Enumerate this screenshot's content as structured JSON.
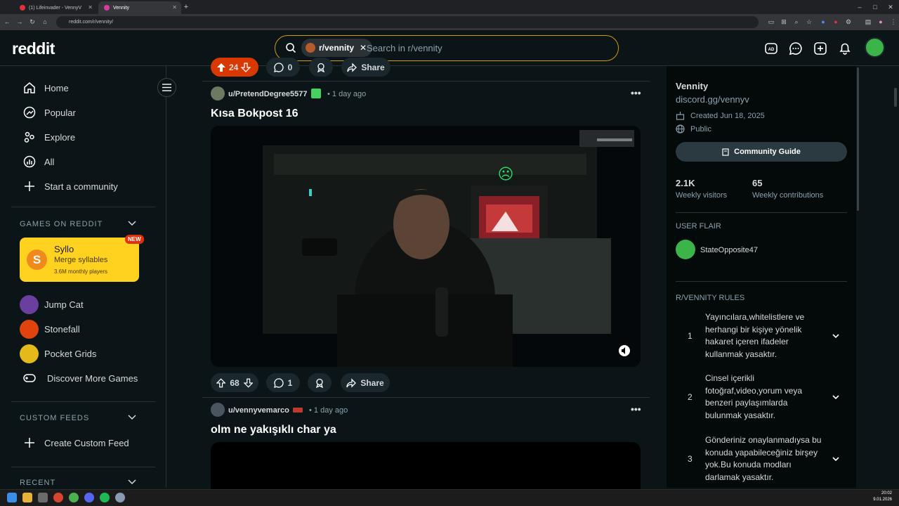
{
  "browser": {
    "tabs": [
      {
        "label": "(1) Lifeinvader - VennyV",
        "color": "#e0313d"
      },
      {
        "label": "Vennity",
        "color": "#d93a9e"
      }
    ],
    "new_tab_icon": "plus-icon",
    "url": "reddit.com/r/vennity/"
  },
  "header": {
    "logo": "reddit",
    "search_chip": "r/vennity",
    "search_placeholder": "Search in r/vennity",
    "accent": "#d49b0b"
  },
  "sidebar": {
    "nav": [
      {
        "label": "Home",
        "icon": "home-icon"
      },
      {
        "label": "Popular",
        "icon": "popular-icon"
      },
      {
        "label": "Explore",
        "icon": "explore-icon"
      },
      {
        "label": "All",
        "icon": "all-icon"
      },
      {
        "label": "Start a community",
        "icon": "plus-icon"
      }
    ],
    "games_title": "GAMES ON REDDIT",
    "featured": {
      "title": "Syllo",
      "subtitle": "Merge syllables",
      "players": "3.6M monthly players",
      "badge": "NEW"
    },
    "games": [
      "Jump Cat",
      "Stonefall",
      "Pocket Grids",
      "Discover More Games"
    ],
    "feeds_title": "CUSTOM FEEDS",
    "create_feed": "Create Custom Feed",
    "recent_title": "RECENT"
  },
  "feed": {
    "top_bar": {
      "votes": "24",
      "comments": "0",
      "share": "Share"
    },
    "posts": [
      {
        "user": "u/PretendDegree5577",
        "time": "• 1 day ago",
        "title": "Kısa Bokpost 16",
        "votes": "68",
        "comments": "1",
        "share": "Share"
      },
      {
        "user": "u/vennyvemarco",
        "time": "• 1 day ago",
        "title": "olm ne yakışıklı char ya"
      }
    ]
  },
  "community": {
    "name": "Vennity",
    "link": "discord.gg/vennyv",
    "created": "Created Jun 18, 2025",
    "visibility": "Public",
    "guide_label": "Community Guide",
    "visitors": "2.1K",
    "visitors_label": "Weekly visitors",
    "contributions": "65",
    "contributions_label": "Weekly contributions",
    "flair_title": "USER FLAIR",
    "flair_user": "StateOpposite47",
    "rules_title": "R/VENNITY RULES",
    "rules": [
      {
        "num": "1",
        "text": "Yayıncılara,whitelistlere ve herhangi bir kişiye yönelik hakaret içeren ifadeler kullanmak yasaktır."
      },
      {
        "num": "2",
        "text": "Cinsel içerikli fotoğraf,video,yorum veya benzeri paylaşımlarda bulunmak yasaktır."
      },
      {
        "num": "3",
        "text": "Gönderiniz onaylanmadıysa bu konuda yapabileceğiniz birşey yok.Bu konuda modları darlamak yasaktır."
      }
    ]
  },
  "taskbar": {
    "time": "20:02",
    "date": "9.01.2026"
  }
}
